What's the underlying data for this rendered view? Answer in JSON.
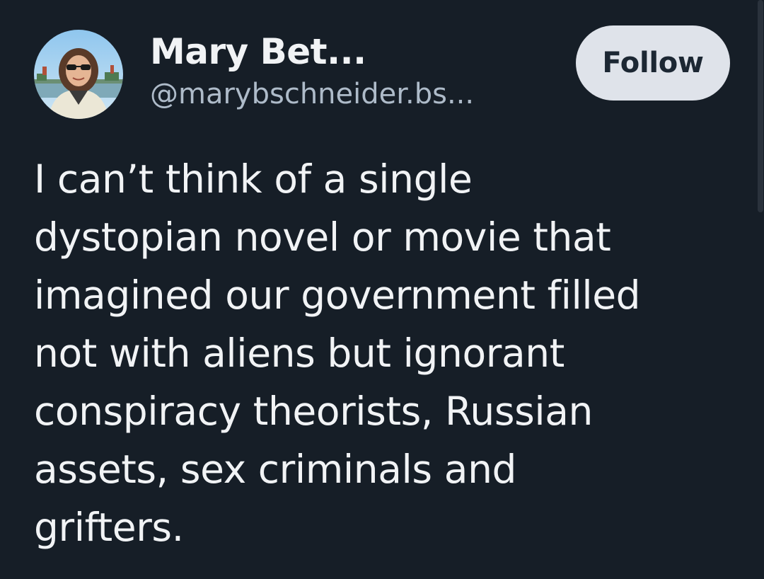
{
  "post": {
    "author": {
      "display_name": "Mary Bet...",
      "handle": "@marybschneider.bs..."
    },
    "follow_label": "Follow",
    "text": "I can’t think of a single\ndystopian novel or movie that\nimagined our government filled\nnot with aliens but ignorant\nconspiracy theorists, Russian\nassets, sex criminals and\ngrifters."
  },
  "colors": {
    "background": "#161e27",
    "text": "#f1f3f5",
    "handle": "#aebbc9",
    "follow_button_bg": "#dfe3ea",
    "follow_button_text": "#1c2733"
  },
  "icons": {
    "avatar": "profile-photo"
  }
}
